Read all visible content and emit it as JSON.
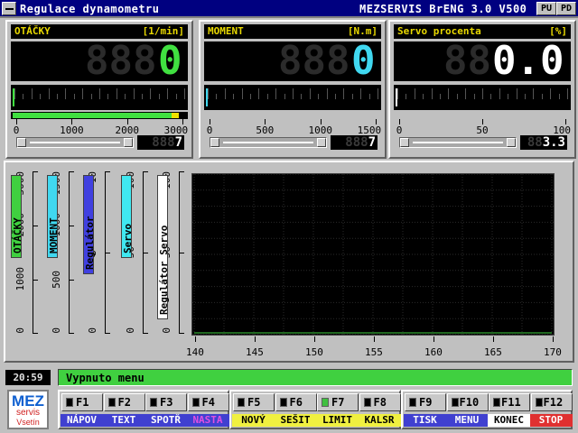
{
  "window": {
    "title": "Regulace dynamometru",
    "app_name": "MEZSERVIS BrENG 3.0 V500",
    "buttons": [
      "PU",
      "PD"
    ]
  },
  "panels": [
    {
      "title": "OTÁČKY",
      "unit": "[1/min]",
      "ghost": "888",
      "value": "0",
      "value_color": "#40e040",
      "scale": [
        "0",
        "1000",
        "2000",
        "3000"
      ],
      "level_fraction": 0.0,
      "setpoint_ghost": "888",
      "setpoint": "7"
    },
    {
      "title": "MOMENT",
      "unit": "[N.m]",
      "ghost": "888",
      "value": "0",
      "value_color": "#40d8f0",
      "scale": [
        "0",
        "500",
        "1000",
        "1500"
      ],
      "level_fraction": 0.0,
      "setpoint_ghost": "888",
      "setpoint": "7"
    },
    {
      "title": "Servo procenta",
      "unit": "[%]",
      "ghost": "88",
      "value": "0.0",
      "value_color": "#ffffff",
      "scale": [
        "0",
        "50",
        "100"
      ],
      "level_fraction": 0.0,
      "setpoint_ghost": "88",
      "setpoint": "3.3"
    }
  ],
  "vertical_scales": [
    {
      "name": "OTÁČKY",
      "ticks": [
        "0",
        "1000",
        "2000",
        "3000"
      ],
      "color": "#40d040",
      "text_color": "#000"
    },
    {
      "name": "MOMENT",
      "ticks": [
        "0",
        "500",
        "1000",
        "1500"
      ],
      "color": "#40d8f0",
      "text_color": "#000"
    },
    {
      "name": "Regulátor",
      "ticks": [
        "0",
        "5",
        "10"
      ],
      "color": "#4040e0",
      "text_color": "#000"
    },
    {
      "name": "Servo",
      "ticks": [
        "0",
        "50",
        "100"
      ],
      "color": "#40e8f0",
      "text_color": "#000"
    },
    {
      "name": "Regulátor Servo",
      "ticks": [
        "0",
        "50",
        "100"
      ],
      "color": "#ffffff",
      "text_color": "#000"
    }
  ],
  "chart_data": {
    "type": "line",
    "x_ticks": [
      "140",
      "145",
      "150",
      "155",
      "160",
      "165",
      "170"
    ],
    "xlim": [
      140,
      170
    ],
    "ylim": [
      0,
      100
    ],
    "grid": true,
    "series": [
      {
        "color": "#40d040",
        "x": [
          140,
          170
        ],
        "y": [
          0,
          0
        ]
      }
    ]
  },
  "status": {
    "clock": "20:59",
    "message": "Vypnuto menu"
  },
  "logo": {
    "line1": "MEZ",
    "line2": "servis",
    "line3": "Vsetín"
  },
  "fkeys": [
    {
      "key": "F1",
      "label": "NÁPOV",
      "bg": "#4040d0",
      "fg": "#ffffff",
      "led": false
    },
    {
      "key": "F2",
      "label": "TEXT",
      "bg": "#4040d0",
      "fg": "#ffffff",
      "led": false
    },
    {
      "key": "F3",
      "label": "SPOTŘ",
      "bg": "#4040d0",
      "fg": "#ffffff",
      "led": false
    },
    {
      "key": "F4",
      "label": "NASTA",
      "bg": "#4040d0",
      "fg": "#e050e0",
      "led": false
    },
    {
      "key": "F5",
      "label": "NOVÝ",
      "bg": "#f0f040",
      "fg": "#000000",
      "led": false
    },
    {
      "key": "F6",
      "label": "SEŠIT",
      "bg": "#f0f040",
      "fg": "#000000",
      "led": false
    },
    {
      "key": "F7",
      "label": "LIMIT",
      "bg": "#f0f040",
      "fg": "#000000",
      "led": true
    },
    {
      "key": "F8",
      "label": "KALSR",
      "bg": "#f0f040",
      "fg": "#000000",
      "led": false
    },
    {
      "key": "F9",
      "label": "TISK",
      "bg": "#4040d0",
      "fg": "#ffffff",
      "led": false
    },
    {
      "key": "F10",
      "label": "MENU",
      "bg": "#4040d0",
      "fg": "#ffffff",
      "led": false
    },
    {
      "key": "F11",
      "label": "KONEC",
      "bg": "#ffffff",
      "fg": "#000000",
      "led": false
    },
    {
      "key": "F12",
      "label": "STOP",
      "bg": "#e03030",
      "fg": "#ffffff",
      "led": false
    }
  ]
}
